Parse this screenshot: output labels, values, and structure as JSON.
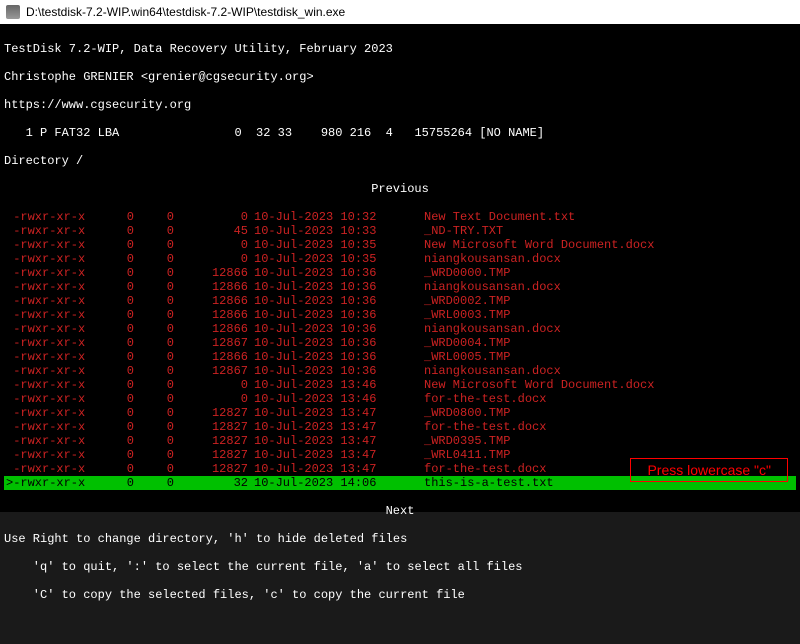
{
  "titlebar": {
    "path": "D:\\testdisk-7.2-WIP.win64\\testdisk-7.2-WIP\\testdisk_win.exe"
  },
  "header": {
    "app_line": "TestDisk 7.2-WIP, Data Recovery Utility, February 2023",
    "author_line": "Christophe GRENIER <grenier@cgsecurity.org>",
    "url_line": "https://www.cgsecurity.org",
    "partition_line": "   1 P FAT32 LBA                0  32 33    980 216  4   15755264 [NO NAME]",
    "dir_line": "Directory /"
  },
  "previous_label": "Previous",
  "next_label": "Next",
  "files": [
    {
      "perm": " -rwxr-xr-x",
      "u": "0",
      "g": "0",
      "size": "0",
      "dt": "10-Jul-2023 10:32",
      "name": "New Text Document.txt",
      "sel": false
    },
    {
      "perm": " -rwxr-xr-x",
      "u": "0",
      "g": "0",
      "size": "45",
      "dt": "10-Jul-2023 10:33",
      "name": "_ND-TRY.TXT",
      "sel": false
    },
    {
      "perm": " -rwxr-xr-x",
      "u": "0",
      "g": "0",
      "size": "0",
      "dt": "10-Jul-2023 10:35",
      "name": "New Microsoft Word Document.docx",
      "sel": false
    },
    {
      "perm": " -rwxr-xr-x",
      "u": "0",
      "g": "0",
      "size": "0",
      "dt": "10-Jul-2023 10:35",
      "name": "niangkousansan.docx",
      "sel": false
    },
    {
      "perm": " -rwxr-xr-x",
      "u": "0",
      "g": "0",
      "size": "12866",
      "dt": "10-Jul-2023 10:36",
      "name": "_WRD0000.TMP",
      "sel": false
    },
    {
      "perm": " -rwxr-xr-x",
      "u": "0",
      "g": "0",
      "size": "12866",
      "dt": "10-Jul-2023 10:36",
      "name": "niangkousansan.docx",
      "sel": false
    },
    {
      "perm": " -rwxr-xr-x",
      "u": "0",
      "g": "0",
      "size": "12866",
      "dt": "10-Jul-2023 10:36",
      "name": "_WRD0002.TMP",
      "sel": false
    },
    {
      "perm": " -rwxr-xr-x",
      "u": "0",
      "g": "0",
      "size": "12866",
      "dt": "10-Jul-2023 10:36",
      "name": "_WRL0003.TMP",
      "sel": false
    },
    {
      "perm": " -rwxr-xr-x",
      "u": "0",
      "g": "0",
      "size": "12866",
      "dt": "10-Jul-2023 10:36",
      "name": "niangkousansan.docx",
      "sel": false
    },
    {
      "perm": " -rwxr-xr-x",
      "u": "0",
      "g": "0",
      "size": "12867",
      "dt": "10-Jul-2023 10:36",
      "name": "_WRD0004.TMP",
      "sel": false
    },
    {
      "perm": " -rwxr-xr-x",
      "u": "0",
      "g": "0",
      "size": "12866",
      "dt": "10-Jul-2023 10:36",
      "name": "_WRL0005.TMP",
      "sel": false
    },
    {
      "perm": " -rwxr-xr-x",
      "u": "0",
      "g": "0",
      "size": "12867",
      "dt": "10-Jul-2023 10:36",
      "name": "niangkousansan.docx",
      "sel": false
    },
    {
      "perm": " -rwxr-xr-x",
      "u": "0",
      "g": "0",
      "size": "0",
      "dt": "10-Jul-2023 13:46",
      "name": "New Microsoft Word Document.docx",
      "sel": false
    },
    {
      "perm": " -rwxr-xr-x",
      "u": "0",
      "g": "0",
      "size": "0",
      "dt": "10-Jul-2023 13:46",
      "name": "for-the-test.docx",
      "sel": false
    },
    {
      "perm": " -rwxr-xr-x",
      "u": "0",
      "g": "0",
      "size": "12827",
      "dt": "10-Jul-2023 13:47",
      "name": "_WRD0800.TMP",
      "sel": false
    },
    {
      "perm": " -rwxr-xr-x",
      "u": "0",
      "g": "0",
      "size": "12827",
      "dt": "10-Jul-2023 13:47",
      "name": "for-the-test.docx",
      "sel": false
    },
    {
      "perm": " -rwxr-xr-x",
      "u": "0",
      "g": "0",
      "size": "12827",
      "dt": "10-Jul-2023 13:47",
      "name": "_WRD0395.TMP",
      "sel": false
    },
    {
      "perm": " -rwxr-xr-x",
      "u": "0",
      "g": "0",
      "size": "12827",
      "dt": "10-Jul-2023 13:47",
      "name": "_WRL0411.TMP",
      "sel": false
    },
    {
      "perm": " -rwxr-xr-x",
      "u": "0",
      "g": "0",
      "size": "12827",
      "dt": "10-Jul-2023 13:47",
      "name": "for-the-test.docx",
      "sel": false
    },
    {
      "perm": ">-rwxr-xr-x",
      "u": "0",
      "g": "0",
      "size": "32",
      "dt": "10-Jul-2023 14:06",
      "name": "this-is-a-test.txt",
      "sel": true
    }
  ],
  "help": {
    "line1": "Use Right to change directory, 'h' to hide deleted files",
    "line2": "    'q' to quit, ':' to select the current file, 'a' to select all files",
    "line3": "    'C' to copy the selected files, 'c' to copy the current file"
  },
  "callout": {
    "text": "Press lowercase \"c\""
  }
}
